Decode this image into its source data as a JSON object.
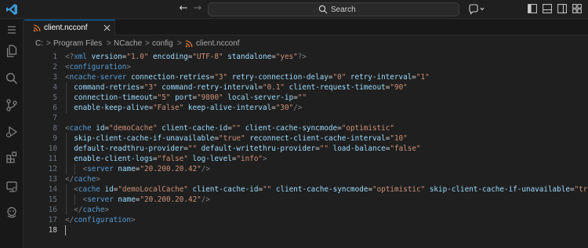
{
  "search": {
    "label": "Search"
  },
  "tab": {
    "label": "client.ncconf"
  },
  "breadcrumb": {
    "parts": [
      "C:",
      "Program Files",
      "NCache",
      "config",
      "client.ncconf"
    ],
    "separator": ">"
  },
  "colors": {
    "accent": "#0078d4",
    "tag": "#569cd6",
    "attribute": "#9cdcfe",
    "string": "#ce9178",
    "bracket": "#808080"
  },
  "editor": {
    "active_line": 18,
    "lines": [
      {
        "n": "1",
        "indent": 0,
        "tokens": [
          [
            "brk",
            "<?"
          ],
          [
            "tag",
            "xml"
          ],
          [
            "sp",
            " "
          ],
          [
            "attr",
            "version"
          ],
          [
            "eq",
            "="
          ],
          [
            "str",
            "\"1.0\""
          ],
          [
            "sp",
            " "
          ],
          [
            "attr",
            "encoding"
          ],
          [
            "eq",
            "="
          ],
          [
            "str",
            "\"UTF-8\""
          ],
          [
            "sp",
            " "
          ],
          [
            "attr",
            "standalone"
          ],
          [
            "eq",
            "="
          ],
          [
            "str",
            "\"yes\""
          ],
          [
            "brk",
            "?>"
          ]
        ]
      },
      {
        "n": "2",
        "indent": 0,
        "tokens": [
          [
            "brk",
            "<"
          ],
          [
            "tag",
            "configuration"
          ],
          [
            "brk",
            ">"
          ]
        ]
      },
      {
        "n": "3",
        "indent": 0,
        "tokens": [
          [
            "brk",
            "<"
          ],
          [
            "tag",
            "ncache-server"
          ],
          [
            "sp",
            " "
          ],
          [
            "attr",
            "connection-retries"
          ],
          [
            "eq",
            "="
          ],
          [
            "str",
            "\"3\""
          ],
          [
            "sp",
            " "
          ],
          [
            "attr",
            "retry-connection-delay"
          ],
          [
            "eq",
            "="
          ],
          [
            "str",
            "\"0\""
          ],
          [
            "sp",
            " "
          ],
          [
            "attr",
            "retry-interval"
          ],
          [
            "eq",
            "="
          ],
          [
            "str",
            "\"1\""
          ]
        ]
      },
      {
        "n": "4",
        "indent": 1,
        "tokens": [
          [
            "attr",
            "command-retries"
          ],
          [
            "eq",
            "="
          ],
          [
            "str",
            "\"3\""
          ],
          [
            "sp",
            " "
          ],
          [
            "attr",
            "command-retry-interval"
          ],
          [
            "eq",
            "="
          ],
          [
            "str",
            "\"0.1\""
          ],
          [
            "sp",
            " "
          ],
          [
            "attr",
            "client-request-timeout"
          ],
          [
            "eq",
            "="
          ],
          [
            "str",
            "\"90\""
          ]
        ]
      },
      {
        "n": "5",
        "indent": 1,
        "tokens": [
          [
            "attr",
            "connection-timeout"
          ],
          [
            "eq",
            "="
          ],
          [
            "str",
            "\"5\""
          ],
          [
            "sp",
            " "
          ],
          [
            "attr",
            "port"
          ],
          [
            "eq",
            "="
          ],
          [
            "str",
            "\"9800\""
          ],
          [
            "sp",
            " "
          ],
          [
            "attr",
            "local-server-ip"
          ],
          [
            "eq",
            "="
          ],
          [
            "str",
            "\"\""
          ]
        ]
      },
      {
        "n": "6",
        "indent": 1,
        "tokens": [
          [
            "attr",
            "enable-keep-alive"
          ],
          [
            "eq",
            "="
          ],
          [
            "str",
            "\"False\""
          ],
          [
            "sp",
            " "
          ],
          [
            "attr",
            "keep-alive-interval"
          ],
          [
            "eq",
            "="
          ],
          [
            "str",
            "\"30\""
          ],
          [
            "brk",
            "/>"
          ]
        ]
      },
      {
        "n": "7",
        "indent": 0,
        "tokens": []
      },
      {
        "n": "8",
        "indent": 0,
        "tokens": [
          [
            "brk",
            "<"
          ],
          [
            "tag",
            "cache"
          ],
          [
            "sp",
            " "
          ],
          [
            "attr",
            "id"
          ],
          [
            "eq",
            "="
          ],
          [
            "str",
            "\"demoCache\""
          ],
          [
            "sp",
            " "
          ],
          [
            "attr",
            "client-cache-id"
          ],
          [
            "eq",
            "="
          ],
          [
            "str",
            "\"\""
          ],
          [
            "sp",
            " "
          ],
          [
            "attr",
            "client-cache-syncmode"
          ],
          [
            "eq",
            "="
          ],
          [
            "str",
            "\"optimistic\""
          ]
        ]
      },
      {
        "n": "9",
        "indent": 1,
        "tokens": [
          [
            "attr",
            "skip-client-cache-if-unavailable"
          ],
          [
            "eq",
            "="
          ],
          [
            "str",
            "\"true\""
          ],
          [
            "sp",
            " "
          ],
          [
            "attr",
            "reconnect-client-cache-interval"
          ],
          [
            "eq",
            "="
          ],
          [
            "str",
            "\"10\""
          ]
        ]
      },
      {
        "n": "10",
        "indent": 1,
        "tokens": [
          [
            "attr",
            "default-readthru-provider"
          ],
          [
            "eq",
            "="
          ],
          [
            "str",
            "\"\""
          ],
          [
            "sp",
            " "
          ],
          [
            "attr",
            "default-writethru-provider"
          ],
          [
            "eq",
            "="
          ],
          [
            "str",
            "\"\""
          ],
          [
            "sp",
            " "
          ],
          [
            "attr",
            "load-balance"
          ],
          [
            "eq",
            "="
          ],
          [
            "str",
            "\"false\""
          ]
        ]
      },
      {
        "n": "11",
        "indent": 1,
        "tokens": [
          [
            "attr",
            "enable-client-logs"
          ],
          [
            "eq",
            "="
          ],
          [
            "str",
            "\"false\""
          ],
          [
            "sp",
            " "
          ],
          [
            "attr",
            "log-level"
          ],
          [
            "eq",
            "="
          ],
          [
            "str",
            "\"info\""
          ],
          [
            "brk",
            ">"
          ]
        ]
      },
      {
        "n": "12",
        "indent": 2,
        "tokens": [
          [
            "brk",
            "<"
          ],
          [
            "tag",
            "server"
          ],
          [
            "sp",
            " "
          ],
          [
            "attr",
            "name"
          ],
          [
            "eq",
            "="
          ],
          [
            "str",
            "\"20.200.20.42\""
          ],
          [
            "brk",
            "/>"
          ]
        ]
      },
      {
        "n": "13",
        "indent": 0,
        "tokens": [
          [
            "brk",
            "</"
          ],
          [
            "tag",
            "cache"
          ],
          [
            "brk",
            ">"
          ]
        ]
      },
      {
        "n": "14",
        "indent": 1,
        "tokens": [
          [
            "brk",
            "<"
          ],
          [
            "tag",
            "cache"
          ],
          [
            "sp",
            " "
          ],
          [
            "attr",
            "id"
          ],
          [
            "eq",
            "="
          ],
          [
            "str",
            "\"demoLocalCache\""
          ],
          [
            "sp",
            " "
          ],
          [
            "attr",
            "client-cache-id"
          ],
          [
            "eq",
            "="
          ],
          [
            "str",
            "\"\""
          ],
          [
            "sp",
            " "
          ],
          [
            "attr",
            "client-cache-syncmode"
          ],
          [
            "eq",
            "="
          ],
          [
            "str",
            "\"optimistic\""
          ],
          [
            "sp",
            " "
          ],
          [
            "attr",
            "skip-client-cache-if-unavailable"
          ],
          [
            "eq",
            "="
          ],
          [
            "str",
            "\"true\""
          ]
        ]
      },
      {
        "n": "15",
        "indent": 2,
        "tokens": [
          [
            "brk",
            "<"
          ],
          [
            "tag",
            "server"
          ],
          [
            "sp",
            " "
          ],
          [
            "attr",
            "name"
          ],
          [
            "eq",
            "="
          ],
          [
            "str",
            "\"20.200.20.42\""
          ],
          [
            "brk",
            "/>"
          ]
        ]
      },
      {
        "n": "16",
        "indent": 1,
        "tokens": [
          [
            "brk",
            "</"
          ],
          [
            "tag",
            "cache"
          ],
          [
            "brk",
            ">"
          ]
        ]
      },
      {
        "n": "17",
        "indent": 0,
        "tokens": [
          [
            "brk",
            "</"
          ],
          [
            "tag",
            "configuration"
          ],
          [
            "brk",
            ">"
          ]
        ]
      },
      {
        "n": "18",
        "indent": 0,
        "tokens": []
      }
    ]
  },
  "icons": {
    "activity_bar": [
      "menu-icon",
      "explorer-icon",
      "search-icon",
      "source-control-icon",
      "run-debug-icon",
      "extensions-icon",
      "remote-explorer-icon",
      "accounts-icon"
    ],
    "titlebar": [
      "vscode-logo-icon",
      "arrow-left-icon",
      "arrow-right-icon",
      "search-icon",
      "copilot-icon",
      "toggle-primary-sidebar-icon",
      "toggle-panel-icon",
      "toggle-secondary-sidebar-icon",
      "customize-layout-icon"
    ]
  }
}
